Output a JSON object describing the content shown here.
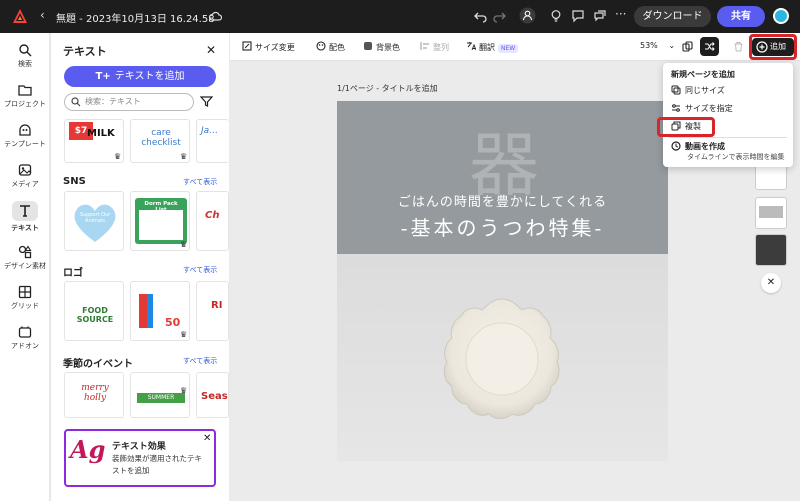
{
  "topbar": {
    "doc_title": "無題 - 2023年10月13日 16.24.58",
    "download_label": "ダウンロード",
    "share_label": "共有"
  },
  "rail": {
    "items": [
      {
        "label": "検索",
        "icon": "search-icon"
      },
      {
        "label": "プロジェクト",
        "icon": "folder-icon"
      },
      {
        "label": "テンプレート",
        "icon": "template-icon"
      },
      {
        "label": "メディア",
        "icon": "media-icon"
      },
      {
        "label": "テキスト",
        "icon": "text-icon"
      },
      {
        "label": "デザイン素材",
        "icon": "shapes-icon"
      },
      {
        "label": "グリッド",
        "icon": "grid-icon"
      },
      {
        "label": "アドオン",
        "icon": "addon-icon"
      }
    ]
  },
  "panel": {
    "title": "テキスト",
    "add_text_label": "テキストを追加",
    "search_placeholder": "検索：テキスト",
    "sections": [
      {
        "title": "SNS",
        "more": "すべて表示"
      },
      {
        "title": "ロゴ",
        "more": "すべて表示"
      },
      {
        "title": "季節のイベント",
        "more": "すべて表示"
      }
    ],
    "thumbs": {
      "t1": "MILK",
      "t2": "care checklist",
      "t3": "Dorm Pack List",
      "t4": "Support Our Animals",
      "t5": "FOOD SOURCE",
      "t6": "50",
      "t7": "merry holly",
      "t8": "SUMMER",
      "t9": "Seas"
    },
    "fx": {
      "logo": "Ag",
      "title": "テキスト効果",
      "desc": "装飾効果が適用されたテキストを追加"
    }
  },
  "toolbar": {
    "resize": "サイズ変更",
    "color": "配色",
    "bg_color": "背景色",
    "align": "整列",
    "translate": "翻訳",
    "new_badge": "NEW",
    "zoom": "53%",
    "add": "追加"
  },
  "canvas": {
    "page_label": "1/1ページ - タイトルを追加",
    "kanji": "器",
    "subtitle": "ごはんの時間を豊かにしてくれる",
    "headline": "-基本のうつわ特集-"
  },
  "dropdown": {
    "header": "新規ページを追加",
    "same_size": "同じサイズ",
    "custom_size": "サイズを指定",
    "duplicate": "複製",
    "video": "動画を作成",
    "video_sub": "タイムラインで表示時間を編集"
  },
  "colors": {
    "accent": "#5a5cf0",
    "highlight": "#d7262a",
    "topbar": "#1d1d1d"
  }
}
